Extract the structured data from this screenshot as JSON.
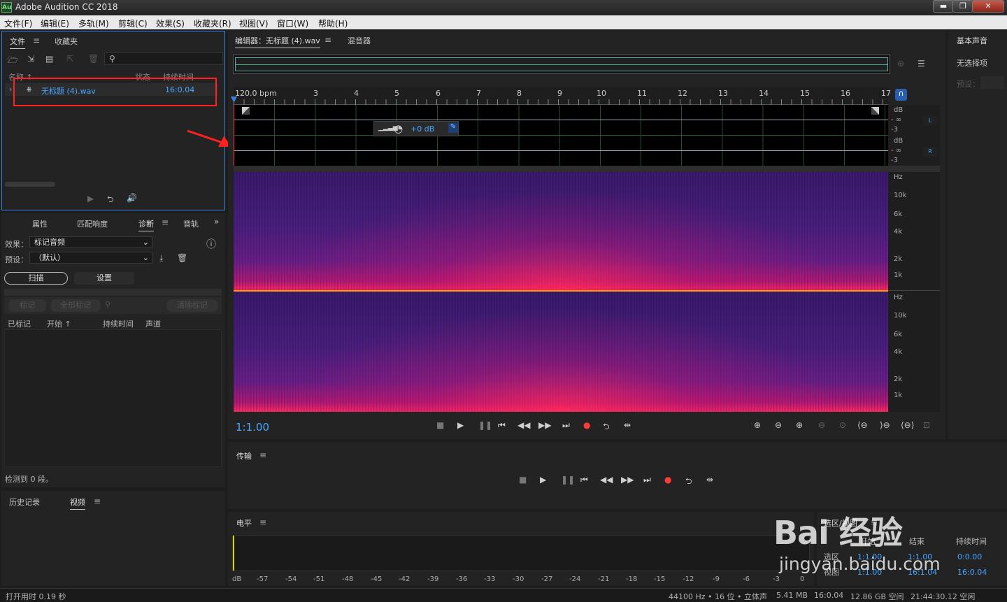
{
  "window": {
    "title": "Adobe Audition CC 2018",
    "logo": "Au"
  },
  "menu": [
    "文件(F)",
    "编辑(E)",
    "多轨(M)",
    "剪辑(C)",
    "效果(S)",
    "收藏夹(R)",
    "视图(V)",
    "窗口(W)",
    "帮助(H)"
  ],
  "files_panel": {
    "tabs": [
      "文件",
      "收藏夹"
    ],
    "col_name": "名称 ↑",
    "col_status": "状态",
    "col_duration": "持续时间",
    "file_name": "无标题 (4).wav",
    "file_duration": "16:0.04"
  },
  "diag_panel": {
    "tabs": [
      "属性",
      "匹配响度",
      "诊断",
      "音轨"
    ],
    "effect_label": "效果：",
    "effect_value": "标记音频",
    "preset_label": "预设：",
    "preset_value": "（默认）",
    "scan_btn": "扫描",
    "settings_btn": "设置",
    "mark_btn": "标记",
    "mark_all_btn": "全部标记",
    "clear_btn": "清除标记",
    "col_marked": "已标记",
    "col_start": "开始 ↑",
    "col_duration": "持续时间",
    "col_channel": "声道",
    "detected": "检测到 0 段。"
  },
  "history_panel": {
    "tabs": [
      "历史记录",
      "视频"
    ]
  },
  "editor": {
    "tab_editor": "编辑器：无标题 (4).wav",
    "tab_mixer": "混音器",
    "bpm": "120.0 bpm",
    "ruler": [
      "3",
      "4",
      "5",
      "6",
      "7",
      "8",
      "9",
      "10",
      "11",
      "12",
      "13",
      "14",
      "15",
      "16",
      "17"
    ],
    "hud_gain": "+0 dB",
    "db_label": "dB",
    "db_inf": "- ∞",
    "db_m3": "-3",
    "ch_left": "L",
    "ch_right": "R",
    "hz": "Hz",
    "freq": [
      "10k",
      "6k",
      "4k",
      "2k",
      "1k"
    ],
    "timecode": "1:1.00"
  },
  "right_panel": {
    "title": "基本声音",
    "no_selection": "无选择项",
    "preset": "预设："
  },
  "transport": {
    "title": "传输"
  },
  "levels": {
    "title": "电平",
    "scale": [
      "dB",
      "-57",
      "-54",
      "-51",
      "-48",
      "-45",
      "-42",
      "-39",
      "-36",
      "-33",
      "-30",
      "-27",
      "-24",
      "-21",
      "-18",
      "-15",
      "-12",
      "-9",
      "-6",
      "-3",
      "0"
    ]
  },
  "selection_view": {
    "title": "选区/视图",
    "col_start": "开始",
    "col_end": "结束",
    "col_duration": "持续时间",
    "row_selection": "选区",
    "row_view": "视图",
    "sel_start": "1:1.00",
    "sel_end": "1:1.00",
    "sel_dur": "0:0.00",
    "view_start": "1:1.00",
    "view_end": "16:1.04",
    "view_dur": "16:0.04"
  },
  "watermark": {
    "brand": "Bai 经验",
    "url": "jingyan.baidu.com"
  },
  "status": {
    "open_time": "打开用时 0.19 秒",
    "sample": "44100 Hz • 16 位 • 立体声",
    "size": "5.41 MB",
    "duration": "16:0.04",
    "free": "12.86 GB 空间",
    "time_free": "21:44:30.12 空闲"
  },
  "colors": {
    "accent": "#4aa6ff",
    "highlight": "#ff2020",
    "spectro": "#4a1f80",
    "record": "#ff3b3b"
  }
}
